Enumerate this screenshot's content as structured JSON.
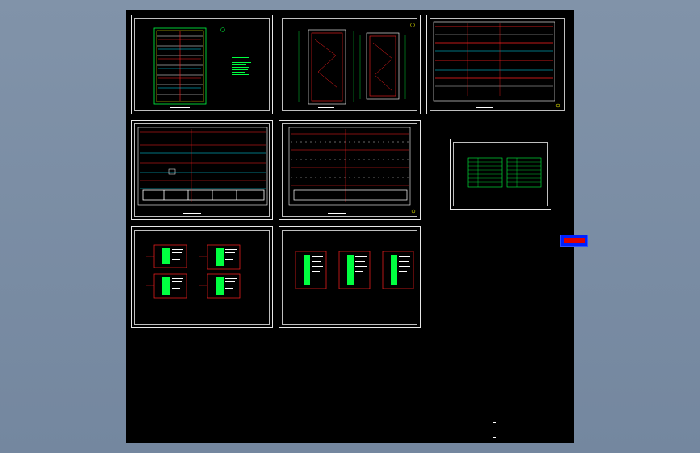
{
  "colors": {
    "background": "#7b8ea5",
    "canvas": "#000000",
    "frame": "#e8e8e8",
    "wire_red": "#ff2020",
    "wire_green": "#00ff40",
    "wire_cyan": "#00e5ff",
    "wire_yellow": "#ffff00",
    "legend_blue": "#0020ff"
  },
  "sheets": [
    {
      "id": "floor-plan-1",
      "kind": "plan-vertical"
    },
    {
      "id": "elevation-pair",
      "kind": "elevations"
    },
    {
      "id": "floor-plan-wide-top",
      "kind": "plan-wide"
    },
    {
      "id": "floor-plan-wide-2",
      "kind": "plan-wide"
    },
    {
      "id": "floor-plan-wide-3",
      "kind": "plan-wide"
    },
    {
      "id": "equipment-table",
      "kind": "table"
    },
    {
      "id": "panel-schedule-4",
      "kind": "schedules"
    },
    {
      "id": "panel-schedule-3",
      "kind": "schedules"
    }
  ],
  "icons": {
    "legend": "color-legend-icon"
  }
}
